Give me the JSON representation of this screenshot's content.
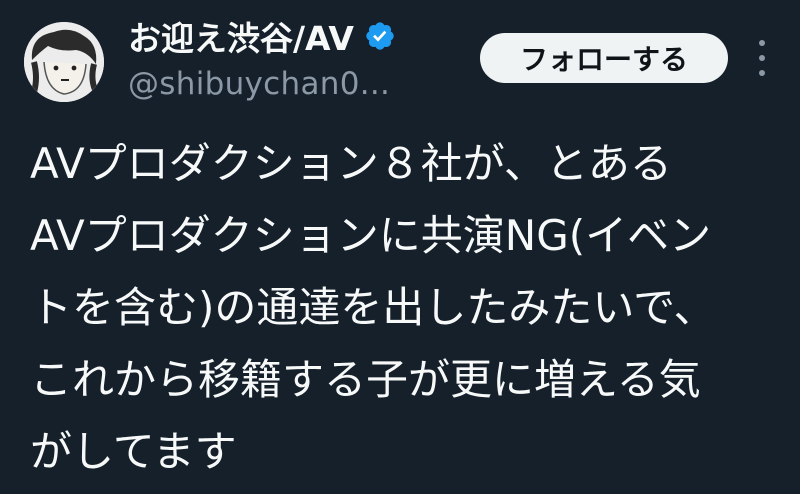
{
  "author": {
    "display_name": "お迎え渋谷/AV",
    "handle": "@shibuychan0...",
    "verified_icon": "verified-badge-icon",
    "avatar_icon": "avatar-illustration"
  },
  "actions": {
    "follow_label": "フォローする",
    "more_icon": "more-vertical-icon"
  },
  "tweet": {
    "lines": [
      "AVプロダクション８社が、とある",
      "AVプロダクションに共演NG(イベン",
      "トを含む)の通達を出したみたいで、",
      "これから移籍する子が更に増える気",
      "がしてます"
    ]
  },
  "colors": {
    "background": "#15202b",
    "text": "#f7f9f9",
    "secondary_text": "#8b98a5",
    "verified_blue": "#1d9bf0",
    "follow_bg": "#eff3f4",
    "follow_text": "#0f1419"
  }
}
